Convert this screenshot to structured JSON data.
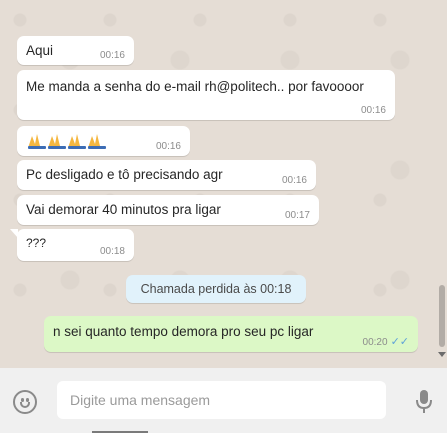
{
  "messages": [
    {
      "text": "Aqui",
      "time": "00:16",
      "direction": "in"
    },
    {
      "text": "Me manda a senha do e-mail rh@politech.. por favoooor",
      "time": "00:16",
      "direction": "in"
    },
    {
      "text": "",
      "emoji": "weary-hands-icon x4",
      "time": "00:16",
      "direction": "in"
    },
    {
      "text": "Pc desligado e tô precisando agr",
      "time": "00:16",
      "direction": "in"
    },
    {
      "text": "Vai demorar 40 minutos pra ligar",
      "time": "00:17",
      "direction": "in"
    },
    {
      "text": "???",
      "time": "00:18",
      "direction": "in"
    },
    {
      "text": "n sei quanto tempo demora pro seu pc ligar",
      "time": "00:20",
      "direction": "out",
      "status": "delivered"
    }
  ],
  "system_notice": "Chamada perdida às 00:18",
  "composer": {
    "placeholder": "Digite uma mensagem"
  },
  "colors": {
    "chat_bg": "#e5ddd5",
    "incoming": "#ffffff",
    "outgoing": "#dcf8c6",
    "notice": "#e1f2fb",
    "ticks": "#5ea2d8"
  }
}
